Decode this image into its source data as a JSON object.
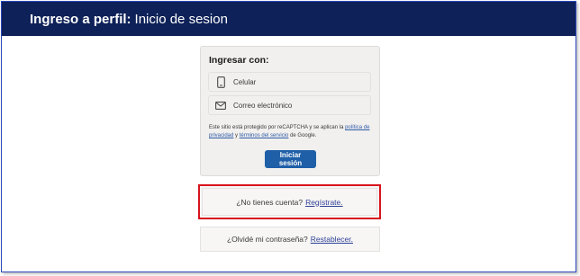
{
  "header": {
    "title_bold": "Ingreso a perfil:",
    "title_rest": "Inicio de sesion"
  },
  "login": {
    "title": "Ingresar con:",
    "options": [
      {
        "icon": "phone-icon",
        "label": "Celular"
      },
      {
        "icon": "mail-icon",
        "label": "Correo electrónico"
      }
    ],
    "legal": {
      "text_before": "Este sitio está protegido por reCAPTCHA y se aplican la",
      "privacy_link": "política de privacidad",
      "and": "y",
      "terms_link": "términos del servicio",
      "text_after": "de Google."
    },
    "submit_label": "Iniciar sesión"
  },
  "register": {
    "question": "¿No tienes cuenta?",
    "link": "Regístrate."
  },
  "forgot": {
    "question": "¿Olvidé mi contraseña?",
    "link": "Restablecer."
  },
  "colors": {
    "header_bg": "#0e2158",
    "button_bg": "#1e5fa8",
    "highlight_border": "#d8141c"
  }
}
